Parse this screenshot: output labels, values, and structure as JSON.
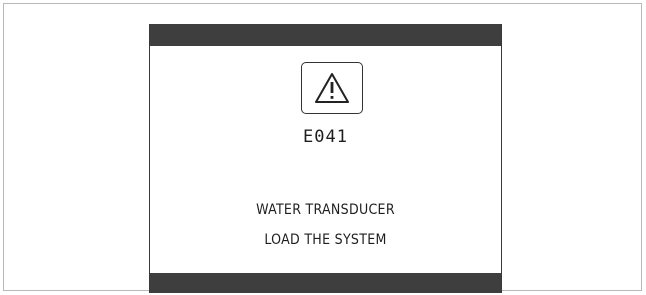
{
  "screen": {
    "icon": "warning-triangle-icon",
    "error_code": "E041",
    "message_line1": "WATER TRANSDUCER",
    "message_line2": "LOAD THE SYSTEM",
    "bar_color": "#3e3e3e"
  }
}
